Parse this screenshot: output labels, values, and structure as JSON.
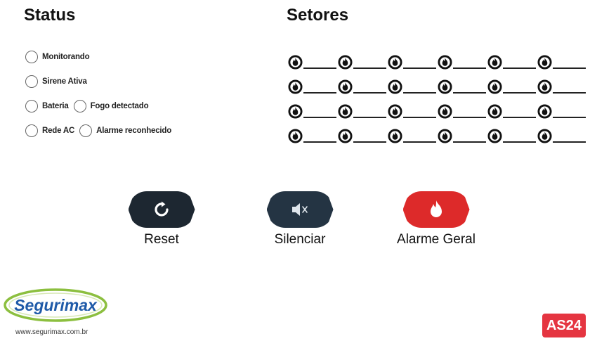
{
  "status": {
    "heading": "Status",
    "rows": [
      [
        {
          "label": "Monitorando"
        }
      ],
      [
        {
          "label": "Sirene Ativa"
        }
      ],
      [
        {
          "label": "Bateria"
        },
        {
          "label": "Fogo detectado"
        }
      ],
      [
        {
          "label": "Rede AC"
        },
        {
          "label": "Alarme reconhecido"
        }
      ]
    ]
  },
  "sectors": {
    "heading": "Setores",
    "rows": 4,
    "columns": 6,
    "icon": "flame-icon"
  },
  "actions": [
    {
      "label": "Reset",
      "icon": "refresh-icon",
      "color": "#1d2731"
    },
    {
      "label": "Silenciar",
      "icon": "speaker-mute-icon",
      "color": "#243443"
    },
    {
      "label": "Alarme Geral",
      "icon": "flame-icon",
      "color": "#dd2a2a"
    }
  ],
  "brand": {
    "logo_text": "Segurimax",
    "url": "www.segurimax.com.br",
    "model": "AS24",
    "model_color": "#e53541"
  }
}
